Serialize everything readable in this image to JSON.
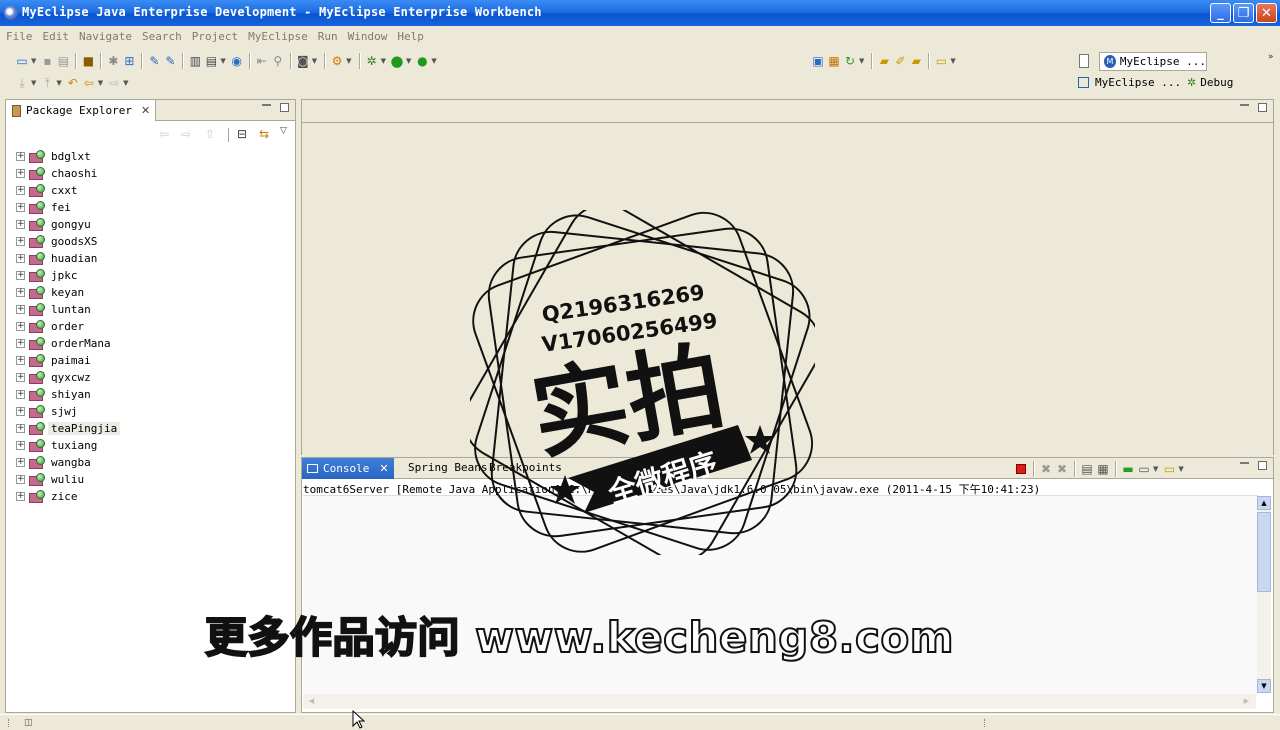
{
  "window": {
    "title": "MyEclipse Java Enterprise Development - MyEclipse Enterprise Workbench",
    "minimize": "_",
    "maximize": "❐",
    "close": "✕"
  },
  "menu": [
    "File",
    "Edit",
    "Navigate",
    "Search",
    "Project",
    "MyEclipse",
    "Run",
    "Window",
    "Help"
  ],
  "perspectives": {
    "active": "MyEclipse ...",
    "secondary": "MyEclipse ...",
    "debug": "Debug"
  },
  "package_explorer": {
    "title": "Package Explorer",
    "projects": [
      "bdglxt",
      "chaoshi",
      "cxxt",
      "fei",
      "gongyu",
      "goodsXS",
      "huadian",
      "jpkc",
      "keyan",
      "luntan",
      "order",
      "orderMana",
      "paimai",
      "qyxcwz",
      "shiyan",
      "sjwj",
      "teaPingjia",
      "tuxiang",
      "wangba",
      "wuliu",
      "zice"
    ],
    "selected": "teaPingjia",
    "expander_symbol": "+"
  },
  "console": {
    "tabs": [
      "Console",
      "Spring Beans",
      "Breakpoints"
    ],
    "header": "tomcat6Server [Remote Java Application] C:\\Program Files\\Java\\jdk1.6.0_05\\bin\\javaw.exe (2011-4-15 下午10:41:23)"
  },
  "watermark": {
    "qq": "Q2196316269",
    "wechat": "V17060256499",
    "big": "实拍",
    "ribbon": "全微程序",
    "footer": "更多作品访问 www.kecheng8.com"
  },
  "colors": {
    "titlebar": "#0a55d0",
    "chrome": "#ece9d8",
    "tab_active": "#2a64c3",
    "stop_button": "#d62020"
  }
}
